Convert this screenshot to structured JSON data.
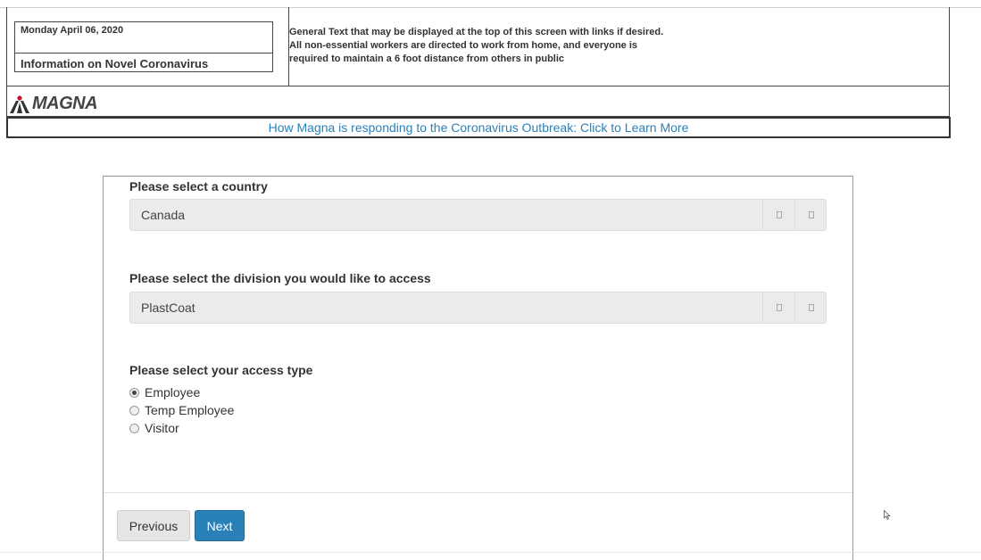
{
  "header": {
    "date": "Monday April 06, 2020",
    "info_title": "Information on Novel Coronavirus",
    "general_text": [
      "General Text that may be displayed at the top of this screen with links if desired.",
      "All non-essential workers are directed to work from home, and everyone is",
      "required to maintain a 6 foot distance from others in public"
    ]
  },
  "brand": {
    "name": "MAGNA",
    "logo_icon": "magna-logo-icon"
  },
  "banner": {
    "link_text": "How Magna is responding to the Coronavirus Outbreak: Click to Learn More"
  },
  "form": {
    "country": {
      "label": "Please select a country",
      "value": "Canada"
    },
    "division": {
      "label": "Please select the division you would like to access",
      "value": "PlastCoat"
    },
    "access_type": {
      "label": "Please select your access type",
      "options": [
        {
          "label": "Employee",
          "checked": true
        },
        {
          "label": "Temp Employee",
          "checked": false
        },
        {
          "label": "Visitor",
          "checked": false
        }
      ]
    }
  },
  "buttons": {
    "previous": "Previous",
    "next": "Next"
  },
  "colors": {
    "accent": "#2a81b8",
    "link": "#2a81b8",
    "border": "#444444"
  }
}
